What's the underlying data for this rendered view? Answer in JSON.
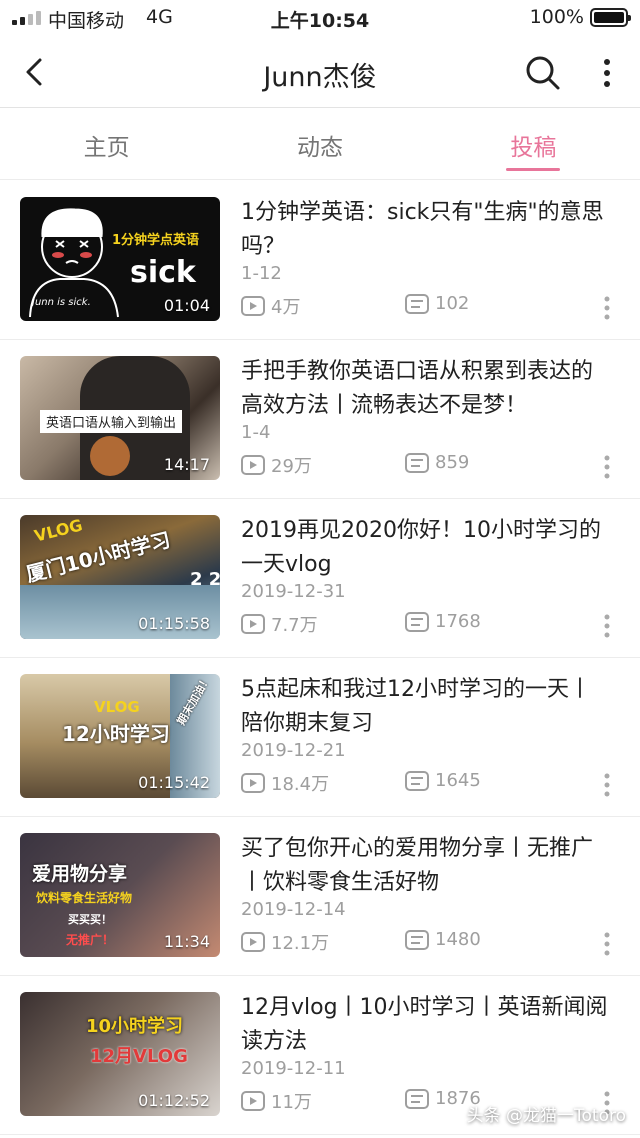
{
  "status_bar": {
    "carrier": "中国移动",
    "network": "4G",
    "time": "上午10:54",
    "battery": "100%",
    "battery_level": 1.0
  },
  "header": {
    "title": "Junn杰俊",
    "icons": [
      "back-arrow-icon",
      "search-icon",
      "more-vertical-icon"
    ]
  },
  "tabs": [
    {
      "label": "主页",
      "active": false
    },
    {
      "label": "动态",
      "active": false
    },
    {
      "label": "投稿",
      "active": true
    }
  ],
  "accent_color": "#e8759a",
  "videos": [
    {
      "title": "1分钟学英语：sick只有\"生病\"的意思吗？",
      "date": "1-12",
      "plays": "4万",
      "danmaku": "102",
      "duration": "01:04",
      "thumb_texts": [
        "1分钟学点英语",
        "sick",
        "Junn is sick."
      ]
    },
    {
      "title": "手把手教你英语口语从积累到表达的高效方法丨流畅表达不是梦！",
      "date": "1-4",
      "plays": "29万",
      "danmaku": "859",
      "duration": "14:17",
      "thumb_texts": [
        "英语口语从输入到输出"
      ]
    },
    {
      "title": "2019再见2020你好！10小时学习的一天vlog",
      "date": "2019-12-31",
      "plays": "7.7万",
      "danmaku": "1768",
      "duration": "01:15:58",
      "thumb_texts": [
        "VLOG",
        "厦门10小时学习",
        "2 2"
      ]
    },
    {
      "title": "5点起床和我过12小时学习的一天丨陪你期末复习",
      "date": "2019-12-21",
      "plays": "18.4万",
      "danmaku": "1645",
      "duration": "01:15:42",
      "thumb_texts": [
        "VLOG",
        "12小时学习",
        "期末加油！"
      ]
    },
    {
      "title": "买了包你开心的爱用物分享丨无推广丨饮料零食生活好物",
      "date": "2019-12-14",
      "plays": "12.1万",
      "danmaku": "1480",
      "duration": "11:34",
      "thumb_texts": [
        "爱用物分享",
        "饮料零食生活好物",
        "买买买！",
        "无推广！"
      ]
    },
    {
      "title": "12月vlog丨10小时学习丨英语新闻阅读方法",
      "date": "2019-12-11",
      "plays": "11万",
      "danmaku": "1876",
      "duration": "01:12:52",
      "thumb_texts": [
        "10小时学习",
        "12月VLOG"
      ]
    }
  ],
  "watermark": "头条 @龙猫一Totoro"
}
